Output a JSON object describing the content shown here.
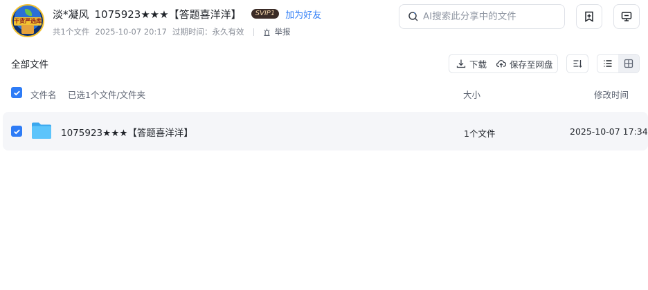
{
  "header": {
    "avatar_text": "干货严选库",
    "owner_name": "淡*凝风",
    "share_title": "1075923★★★【答题喜洋洋】",
    "vip_badge": "SVIP1",
    "add_friend": "加为好友",
    "file_count": "共1个文件",
    "share_time": "2025-10-07 20:17",
    "expire_label": "过期时间：",
    "expire_value": "永久有效",
    "report": "举报"
  },
  "search": {
    "placeholder": "AI搜索此分享中的文件",
    "value": ""
  },
  "top_buttons": {
    "bookmark_icon": "bookmark-plus-icon",
    "device_icon": "monitor-icon"
  },
  "toolbar": {
    "title": "全部文件",
    "download": "下载",
    "save_to_cloud": "保存至网盘",
    "sort_icon": "sort-icon",
    "list_view_icon": "list-view-icon",
    "grid_view_icon": "grid-view-icon"
  },
  "table": {
    "col_name": "文件名",
    "selection_status": "已选1个文件/文件夹",
    "col_size": "大小",
    "col_modified": "修改时间",
    "rows": [
      {
        "name": "1075923★★★【答题喜洋洋】",
        "size": "1个文件",
        "modified": "2025-10-07 17:34",
        "checked": true,
        "icon": "folder-icon"
      }
    ]
  },
  "colors": {
    "accent": "#2e7cf6",
    "folder": "#4fb8f5",
    "row_bg": "#f5f6f9"
  }
}
